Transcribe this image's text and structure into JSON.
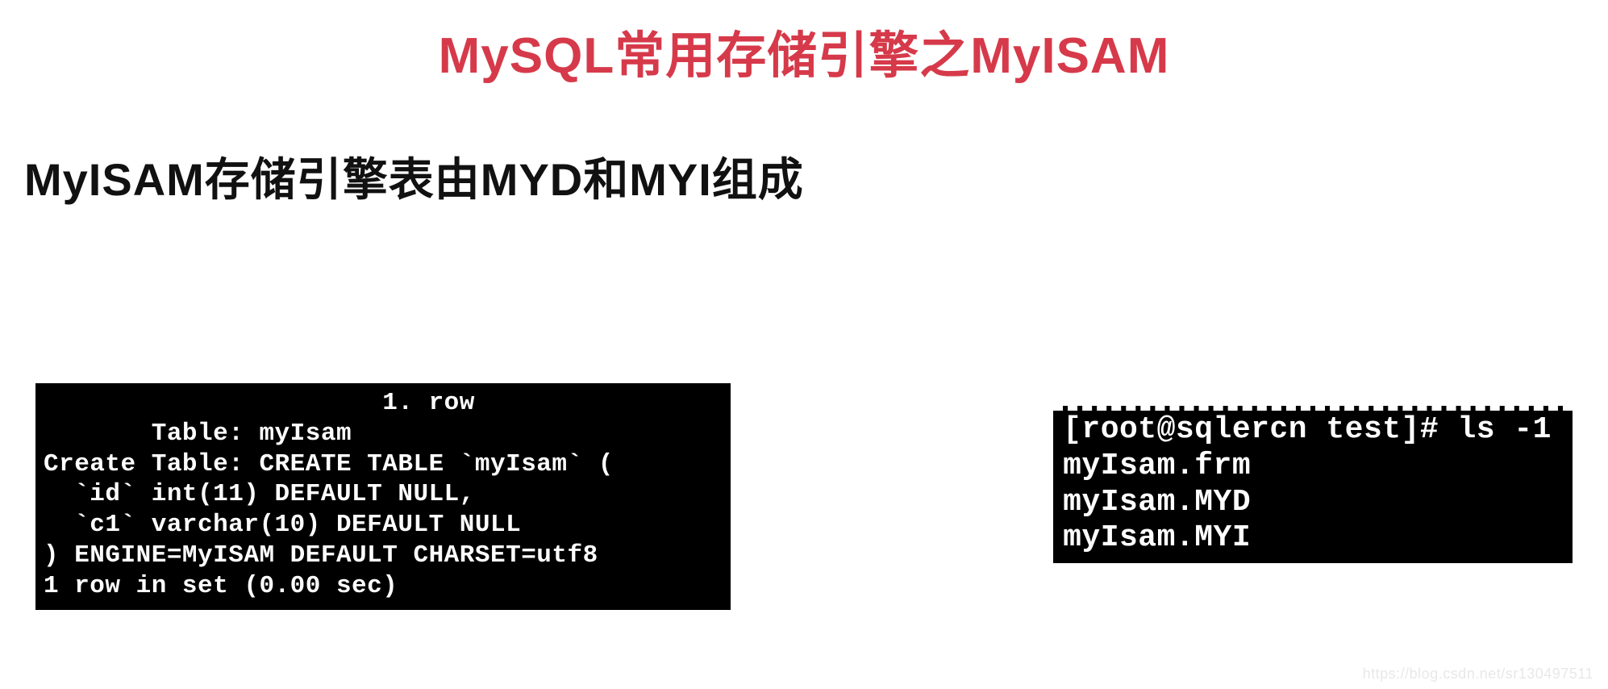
{
  "title": "MySQL常用存储引擎之MyISAM",
  "subtitle": "MyISAM存储引擎表由MYD和MYI组成",
  "terminal_left": "                      1. row\n       Table: myIsam\nCreate Table: CREATE TABLE `myIsam` (\n  `id` int(11) DEFAULT NULL,\n  `c1` varchar(10) DEFAULT NULL\n) ENGINE=MyISAM DEFAULT CHARSET=utf8\n1 row in set (0.00 sec)",
  "terminal_right": "[root@sqlercn test]# ls -1\nmyIsam.frm\nmyIsam.MYD\nmyIsam.MYI",
  "watermark": "https://blog.csdn.net/sr130497511"
}
